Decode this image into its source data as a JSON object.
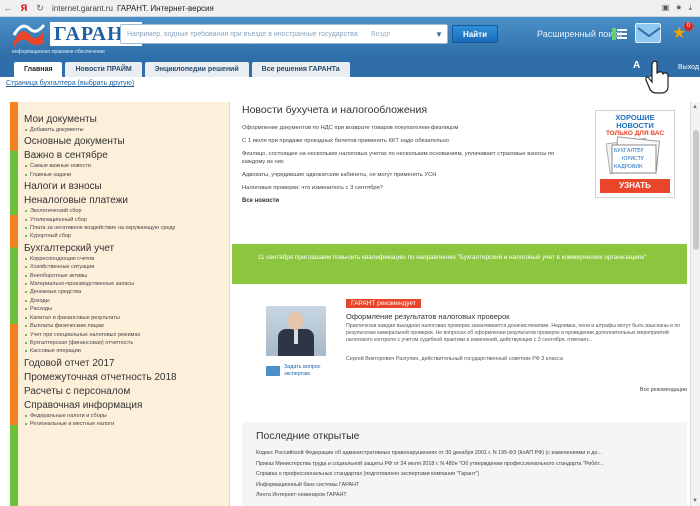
{
  "browser": {
    "back": "←",
    "yandex": "Я",
    "url": "internet.garant.ru",
    "title": "ГАРАНТ. Интернет-версия",
    "download": "⤓"
  },
  "header": {
    "logo_text": "ГАРАНТ",
    "logo_tagline": "информационно-правовое обеспечение",
    "search_placeholder": "Например, водные требования при въезде в иностранные государства",
    "search_scope": "Везде",
    "find_label": "Найти",
    "advanced_label": "Расширенный поиск",
    "mail_badge": "0"
  },
  "tabs": [
    "Главная",
    "Новости ПРАЙМ",
    "Энциклопедии решений",
    "Все решения ГАРАНТа"
  ],
  "font_label": "A",
  "exit_label": "Выход",
  "breadcrumb": "Страница бухгалтера (выбрать другую)",
  "sidebar": {
    "sections": [
      {
        "title": "Мои документы",
        "items": [
          "Добавить документы"
        ]
      },
      {
        "title": "Основные документы",
        "items": []
      },
      {
        "title": "Важно в сентябре",
        "items": [
          "Самые важные новости",
          "Главные задачи"
        ]
      },
      {
        "title": "Налоги и взносы",
        "items": []
      },
      {
        "title": "Неналоговые платежи",
        "items": [
          "Экологический сбор",
          "Утилизационный сбор",
          "Плата за негативное воздействие на окружающую среду",
          "Курортный сбор"
        ]
      },
      {
        "title": "Бухгалтерский учет",
        "items": [
          "Корреспонденция счетов",
          "Хозяйственные ситуации",
          "Внеоборотные активы",
          "Материально-производственные запасы",
          "Денежные средства",
          "Доходы",
          "Расходы",
          "Капитал и финансовые результаты",
          "Выплаты физическим лицам",
          "Учет при специальных налоговых режимах",
          "Бухгалтерская (финансовая) отчетность",
          "Кассовые операции"
        ]
      },
      {
        "title": "Годовой отчет 2017",
        "items": []
      },
      {
        "title": "Промежуточная отчетность 2018",
        "items": []
      },
      {
        "title": "Расчеты с персоналом",
        "items": []
      },
      {
        "title": "Справочная информация",
        "items": [
          "Федеральные налоги и сборы",
          "Региональные и местные налоги"
        ]
      }
    ]
  },
  "news": {
    "title": "Новости бухучета и налогообложения",
    "items": [
      "Оформление документов по НДС при возврате товаров покупателем-физлицом",
      "С 1 июля при продаже проездных билетов применять ККТ надо обязательно",
      "Физлицо, состоящее на нескольких налоговых учетах по нескольким основаниям, уплачивает страховые взносы по каждому из них",
      "Адвокаты, учредившие адвокатские кабинеты, не могут применять УСН",
      "Налоговые проверки: что изменилось с 3 сентября?"
    ],
    "all_label": "Все новости"
  },
  "promo": {
    "title": "ХОРОШИЕ НОВОСТИ",
    "subtitle": "ТОЛЬКО ДЛЯ ВАС",
    "paper1": "БУХГАЛТЕР",
    "paper2": "ЮРИСТУ",
    "paper3": "КАДРОВИК",
    "button": "УЗНАТЬ"
  },
  "banner": "11 сентября приглашаем повысить квалификацию по направлению \"Бухгалтерский и налоговый учет в коммерческих организациях\"",
  "recommend": {
    "badge": "ГАРАНТ рекомендует",
    "title": "Оформление результатов налоговых проверок",
    "text": "Практически каждая выездная налоговая проверка заканчивается доначислениями. Недоимка, пени и штрафы могут быть взысканы и по результатам камеральной проверки. Не вопросах об оформлении результатов проверок и проведении дополнительных мероприятий налогового контроля с учетом судебной практики и изменений, действующих с 3 сентября, отвечает...",
    "author": "Сергей Викторович Разгулин, действительный государственный советник РФ 3 класса",
    "ask_label": "Задать вопрос экспертам",
    "all_label": "Все рекомендации"
  },
  "latest": {
    "title": "Последние открытые",
    "items": [
      "Кодекс Российской Федерации об административных правонарушениях от 30 декабря 2001 г. N 195-ФЗ (КоАП РФ) (с изменениями и до...",
      "Приказ Министерства труда и социальной защиты РФ от 24 июля 2018 г. N 480н \"Об утверждении профессионального стандарта \"Ребёт...",
      "Справка о профессиональных стандартах (подготовлено экспертами компании \"Гарант\")",
      "Информационный банк системы ГАРАНТ",
      "Лента Интернет-семинаров ГАРАНТ"
    ]
  }
}
